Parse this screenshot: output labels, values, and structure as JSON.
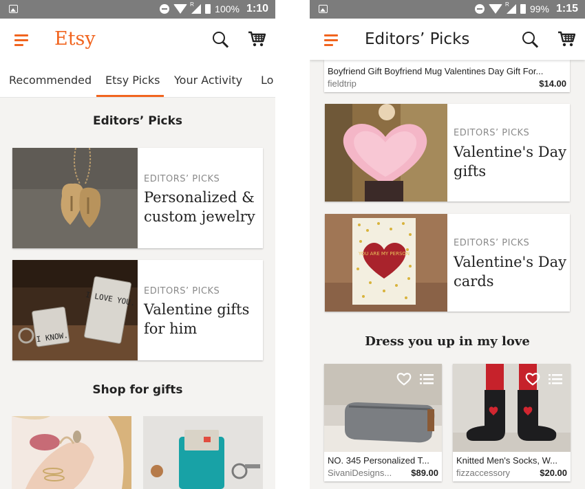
{
  "left_screen": {
    "status": {
      "battery": "100%",
      "time": "1:10"
    },
    "app": {
      "logo": "Etsy"
    },
    "tabs": [
      "Recommended",
      "Etsy Picks",
      "Your Activity",
      "Lo"
    ],
    "editors_section": {
      "title": "Editors’ Picks"
    },
    "cards": [
      {
        "kicker": "EDITORS’ PICKS",
        "title": "Personalized & custom jewelry"
      },
      {
        "kicker": "EDITORS’ PICKS",
        "title": "Valentine gifts for him",
        "image_text": [
          "I LOVE YOU.",
          "I KNOW."
        ]
      }
    ],
    "gifts_section": {
      "title": "Shop for gifts"
    }
  },
  "right_screen": {
    "status": {
      "battery": "99%",
      "time": "1:15"
    },
    "app": {
      "title": "Editors’ Picks"
    },
    "top_listing": {
      "title": "Boyfriend Gift Boyfriend Mug Valentines Day Gift For...",
      "shop": "fieldtrip",
      "price": "$14.00"
    },
    "cards": [
      {
        "kicker": "EDITORS’ PICKS",
        "title": "Valentine's Day gifts"
      },
      {
        "kicker": "EDITORS’ PICKS",
        "title": "Valentine's Day cards",
        "image_text": "YOU ARE MY PERSON"
      }
    ],
    "dress_section": {
      "title": "Dress you up in my love"
    },
    "products": [
      {
        "title": "NO. 345 Personalized T...",
        "shop": "SivaniDesigns...",
        "price": "$89.00"
      },
      {
        "title": "Knitted Men's Socks, W...",
        "shop": "fizzaccessory",
        "price": "$20.00"
      }
    ]
  },
  "colors": {
    "accent": "#f1641e",
    "status_bar": "#7c7c7c",
    "background": "#f4f3f1"
  },
  "icons": [
    "image-notification-icon",
    "do-not-disturb-icon",
    "wifi-icon",
    "signal-icon",
    "battery-icon",
    "menu-icon",
    "search-icon",
    "cart-icon",
    "favorite-heart-icon",
    "add-to-list-icon"
  ]
}
